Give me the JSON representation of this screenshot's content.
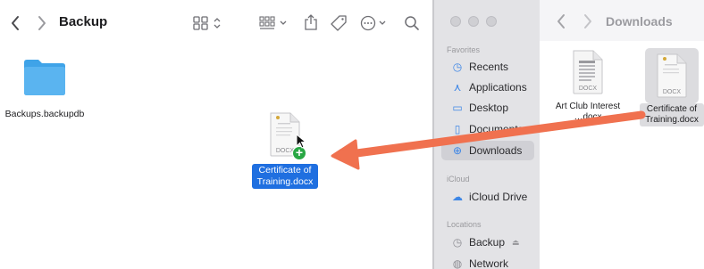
{
  "left_window": {
    "title": "Backup",
    "folder": {
      "name": "Backups.backupdb",
      "color": "#5ab4f0"
    },
    "dragged_file": {
      "name": "Certificate of Training.docx",
      "type_label": "DOCX"
    }
  },
  "right_window": {
    "title": "Downloads",
    "sidebar": {
      "favorites_label": "Favorites",
      "favorites": [
        {
          "label": "Recents",
          "icon": "clock-icon"
        },
        {
          "label": "Applications",
          "icon": "applications-icon"
        },
        {
          "label": "Desktop",
          "icon": "desktop-icon"
        },
        {
          "label": "Documents",
          "icon": "document-icon"
        },
        {
          "label": "Downloads",
          "icon": "download-icon",
          "selected": true
        }
      ],
      "icloud_label": "iCloud",
      "icloud": [
        {
          "label": "iCloud Drive",
          "icon": "cloud-icon"
        }
      ],
      "locations_label": "Locations",
      "locations": [
        {
          "label": "Backup",
          "icon": "clock-icon",
          "eject": true
        },
        {
          "label": "Network",
          "icon": "globe-icon"
        }
      ]
    },
    "files": [
      {
        "name": "Art Club Interest",
        "name_line2": "…docx",
        "type_label": "DOCX"
      },
      {
        "name": "Certificate of Training.docx",
        "type_label": "DOCX",
        "selected": true
      }
    ]
  },
  "annotation": {
    "arrow_color": "#f0714f"
  }
}
